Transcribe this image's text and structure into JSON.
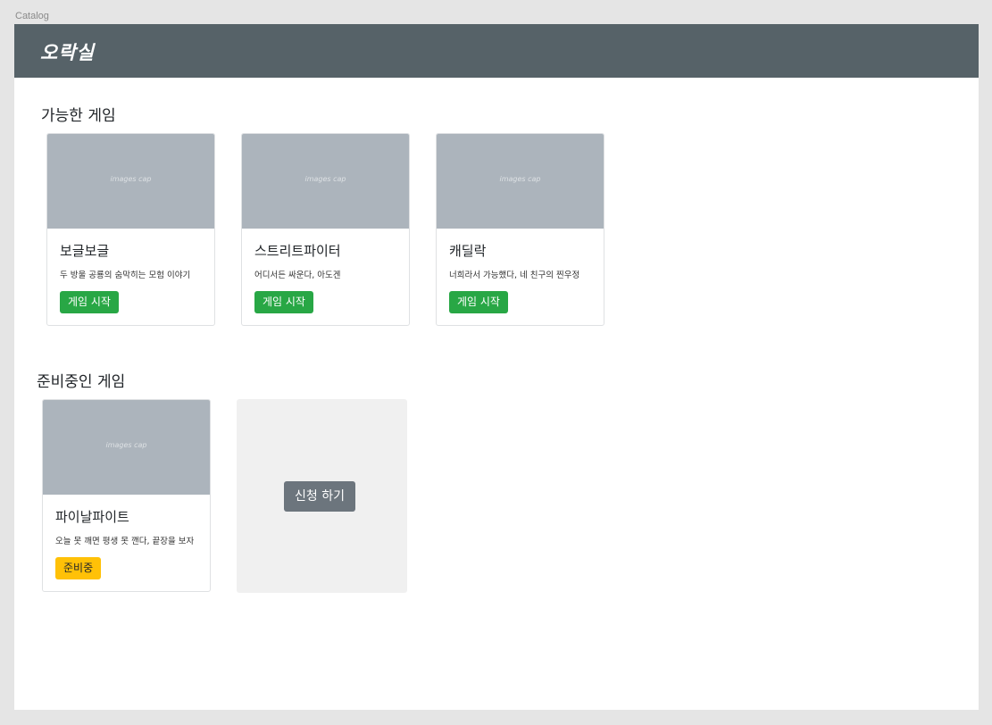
{
  "frame_label": "Catalog",
  "navbar": {
    "brand": "오락실"
  },
  "available_section": {
    "title": "가능한 게임",
    "cards": [
      {
        "image_caption": "images cap",
        "title": "보글보글",
        "description": "두 방울 공룡의 숨막히는 모험 이야기",
        "button_label": "게임 시작"
      },
      {
        "image_caption": "images cap",
        "title": "스트리트파이터",
        "description": "어디서든 싸운다, 아도겐",
        "button_label": "게임 시작"
      },
      {
        "image_caption": "images cap",
        "title": "캐딜락",
        "description": "너희라서 가능했다, 네 친구의 찐우정",
        "button_label": "게임 시작"
      }
    ]
  },
  "upcoming_section": {
    "title": "준비중인 게임",
    "cards": [
      {
        "image_caption": "images cap",
        "title": "파이날파이트",
        "description": "오늘 못 깨면 평생 못 깬다, 끝장을 보자",
        "button_label": "준비중"
      }
    ],
    "apply_button_label": "신청 하기"
  },
  "colors": {
    "navbar": "#566268",
    "success": "#28a745",
    "warning": "#ffc107",
    "secondary": "#6c757d",
    "card_image": "#acb4bc"
  }
}
